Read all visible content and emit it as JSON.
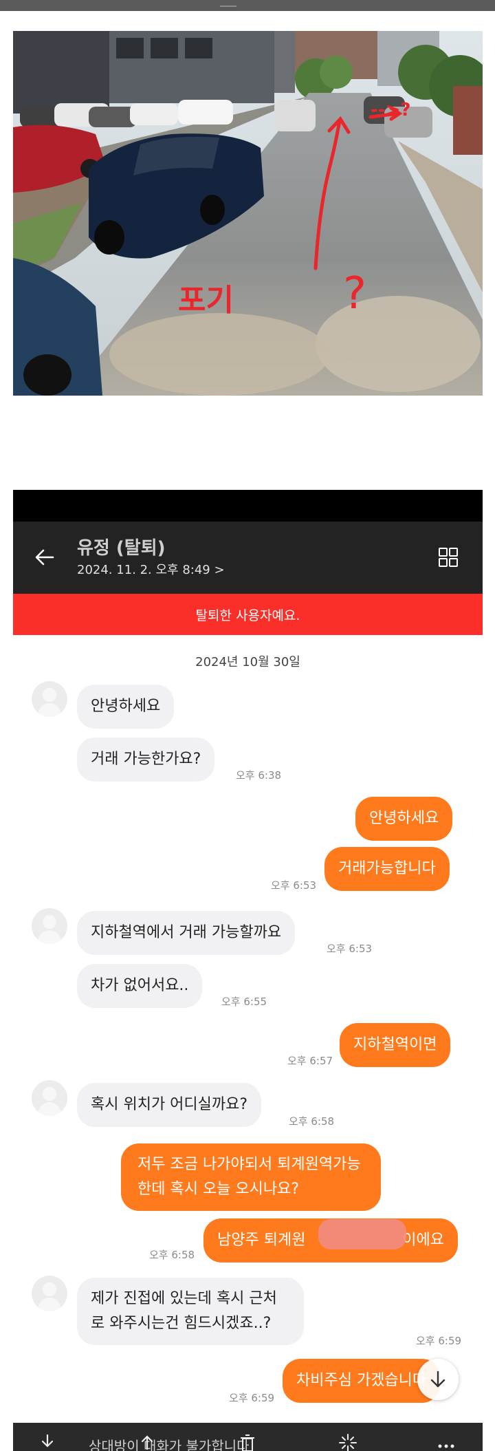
{
  "photo": {
    "annotations": {
      "left_text": "포기",
      "question": "?",
      "arrow_note": "-->?"
    }
  },
  "chat": {
    "header": {
      "name": "유정 (탈퇴)",
      "datetime": "2024. 11. 2. 오후 8:49 >"
    },
    "banner": "탈퇴한 사용자예요.",
    "date_separator": "2024년 10월 30일",
    "messages": [
      {
        "side": "in",
        "text": "안녕하세요",
        "time": ""
      },
      {
        "side": "in",
        "text": "거래 가능한가요?",
        "time": "오후 6:38"
      },
      {
        "side": "out",
        "text": "안녕하세요",
        "time": ""
      },
      {
        "side": "out",
        "text": "거래가능합니다",
        "time": "오후 6:53"
      },
      {
        "side": "in",
        "text": "지하철역에서 거래 가능할까요",
        "time": "오후 6:53"
      },
      {
        "side": "in",
        "text": "차가 없어서요..",
        "time": "오후 6:55"
      },
      {
        "side": "out",
        "text": "지하철역이면",
        "time": "오후 6:57"
      },
      {
        "side": "in",
        "text": "혹시 위치가 어디실까요?",
        "time": "오후 6:58"
      },
      {
        "side": "out",
        "text": "저두 조금 나가야되서 퇴계원역가능한데 혹시 오늘 오시나요?",
        "time": ""
      },
      {
        "side": "out",
        "text": "남양주 퇴계원",
        "suffix": "이에요",
        "time": "오후 6:58"
      },
      {
        "side": "in",
        "text": "제가 진접에 있는데 혹시 근처로 와주시는건 힘드시겠죠..?",
        "time": "오후 6:59"
      },
      {
        "side": "out",
        "text": "차비주심 가겠습니다",
        "time": "오후 6:59"
      }
    ],
    "toolbar_text": "상대방이 대화가 불가합니다"
  },
  "colors": {
    "accent": "#ff7a1c",
    "banner": "#fb2f2a",
    "header_bg": "#232323",
    "incoming_bubble": "#f1f1f3"
  },
  "icons": [
    "back-arrow-icon",
    "grid-menu-icon",
    "scroll-down-icon",
    "download-icon",
    "share-icon",
    "trash-icon",
    "edit-icon",
    "more-icon"
  ]
}
